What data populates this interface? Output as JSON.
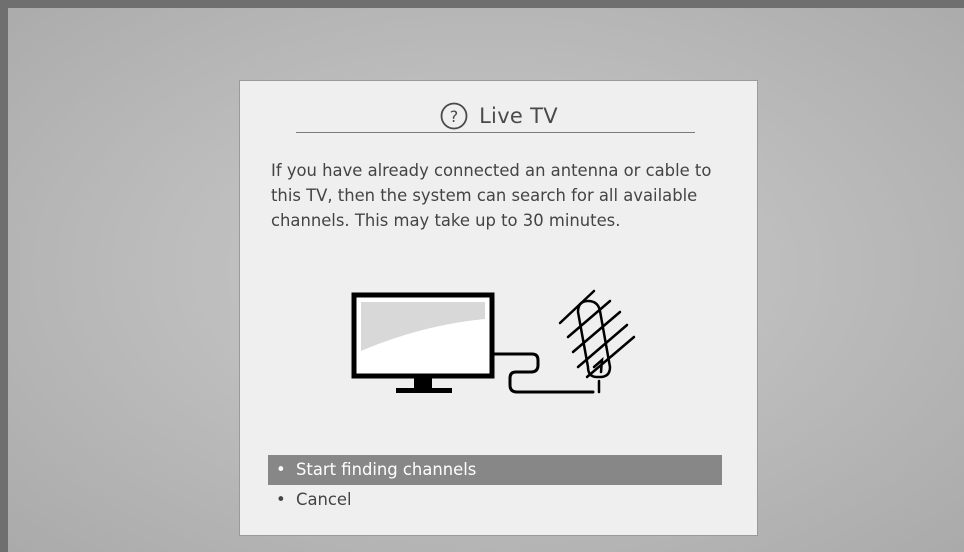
{
  "dialog": {
    "title": "Live TV",
    "help_icon": "question-circle-icon",
    "description": "If you have already connected an antenna or cable to this TV, then the system can search for all available channels. This may take up to 30 minutes.",
    "illustration": "tv-antenna-illustration"
  },
  "menu": {
    "items": [
      {
        "label": "Start finding channels",
        "selected": true
      },
      {
        "label": "Cancel",
        "selected": false
      }
    ],
    "bullet": "•"
  },
  "colors": {
    "selected_bg": "#878787",
    "dialog_bg": "#efefef",
    "text": "#444444"
  }
}
